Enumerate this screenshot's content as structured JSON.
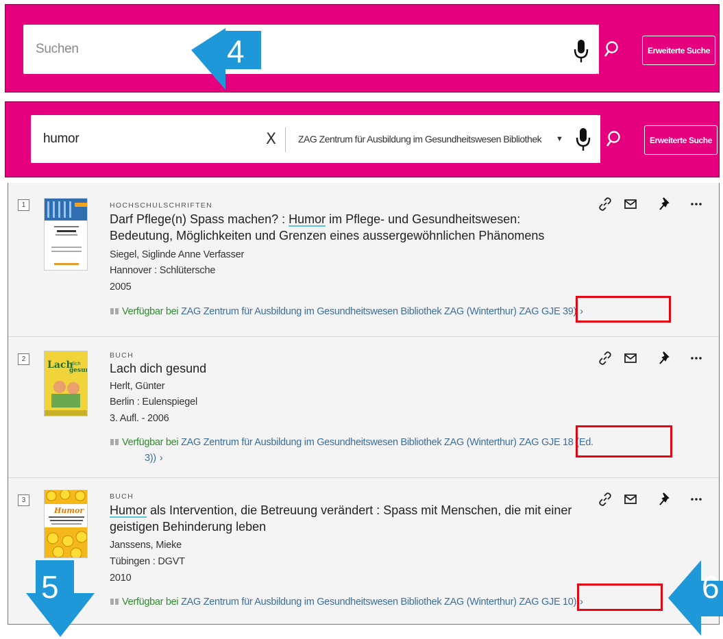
{
  "search_top": {
    "placeholder": "Suchen",
    "advanced_label": "Erweiterte Suche"
  },
  "search_bottom": {
    "query": "humor",
    "clear_icon": "X",
    "scope": "ZAG Zentrum für Ausbildung im Gesundheitswesen Bibliothek",
    "advanced_label": "Erweiterte Suche"
  },
  "annotations": [
    "4",
    "5",
    "6"
  ],
  "colors": {
    "brand": "#e5007d",
    "available": "#2e8b2e",
    "link": "#3c6e9a",
    "highlight_box": "#e30613",
    "arrow": "#1e98d8"
  },
  "results": [
    {
      "number": "1",
      "type": "HOCHSCHULSCHRIFTEN",
      "title_pre": "Darf Pflege(n) Spass machen? : ",
      "title_hl": "Humor",
      "title_post": " im Pflege- und Gesundheitswesen: Bedeutung, Möglichkeiten und Grenzen eines aussergewöhnlichen Phänomens",
      "author": "Siegel, Siglinde Anne Verfasser",
      "publisher": "Hannover : Schlütersche",
      "date": "2005",
      "avail_status": "Verfügbar bei",
      "avail_library": "ZAG Zentrum für Ausbildung im Gesundheitswesen Bibliothek  ZAG (Winterthur)",
      "callnumber": "ZAG GJE 39)",
      "callnumber_cont": ""
    },
    {
      "number": "2",
      "type": "BUCH",
      "title_pre": "Lach dich gesund",
      "title_hl": "",
      "title_post": "",
      "author": "Herlt, Günter",
      "publisher": "Berlin : Eulenspiegel",
      "date": "3. Aufl. - 2006",
      "avail_status": "Verfügbar bei",
      "avail_library": "ZAG Zentrum für Ausbildung im Gesundheitswesen Bibliothek  ZAG (Winterthur)",
      "callnumber": "ZAG GJE 18 (Ed.",
      "callnumber_cont": "3))"
    },
    {
      "number": "3",
      "type": "BUCH",
      "title_pre": "",
      "title_hl": "Humor",
      "title_post": " als Intervention, die Betreuung verändert : Spass mit Menschen, die mit einer geistigen Behinderung leben",
      "author": "Janssens, Mieke",
      "publisher": "Tübingen : DGVT",
      "date": "2010",
      "avail_status": "Verfügbar bei",
      "avail_library": "ZAG Zentrum für Ausbildung im Gesundheitswesen Bibliothek  ZAG (Winterthur)",
      "callnumber": "ZAG GJE 10)",
      "callnumber_cont": ""
    }
  ],
  "icons": [
    "microphone-icon",
    "search-icon",
    "link-icon",
    "email-icon",
    "pin-icon",
    "more-icon",
    "book-icon",
    "chevron-right-icon"
  ]
}
